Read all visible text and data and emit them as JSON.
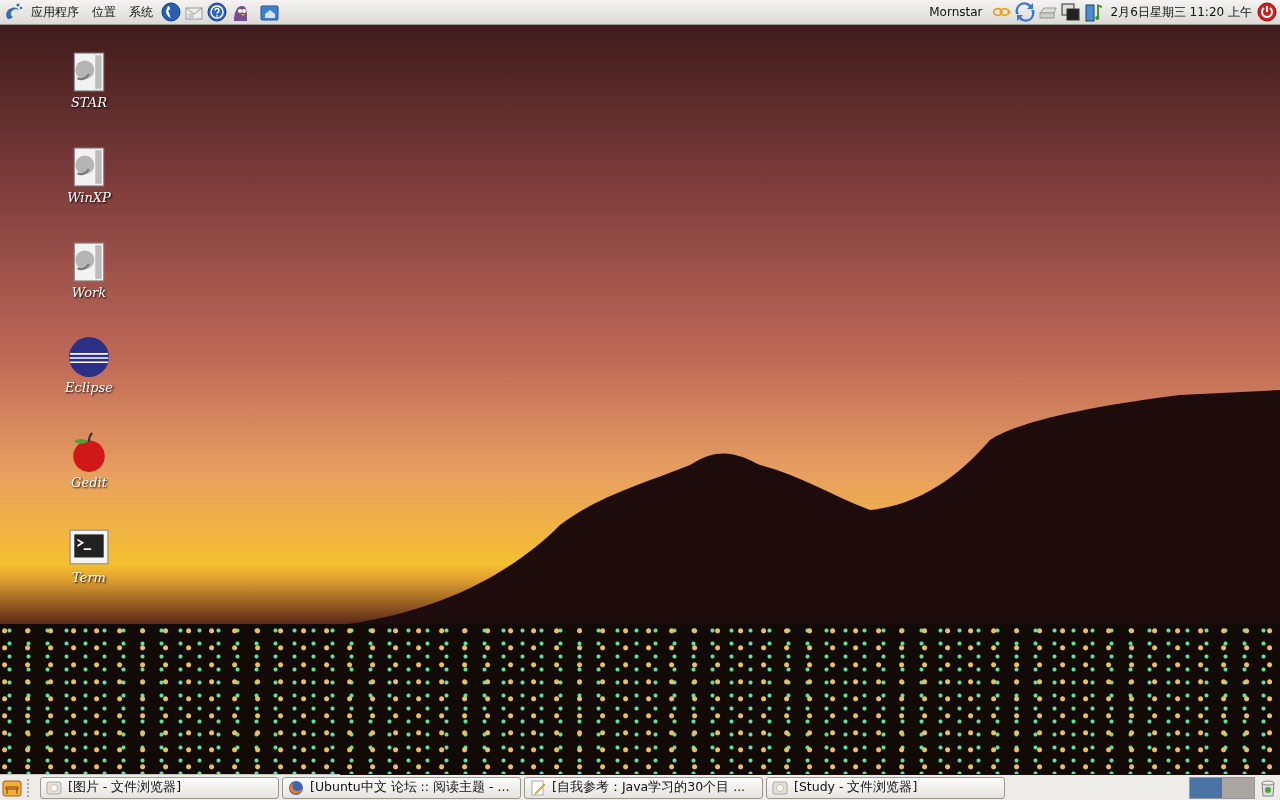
{
  "top_panel": {
    "menus": [
      "应用程序",
      "位置",
      "系统"
    ],
    "user": "Mornstar",
    "clock": "2月6日星期三 11:20 上午"
  },
  "desktop_icons": [
    {
      "label": "STAR",
      "kind": "drive"
    },
    {
      "label": "WinXP",
      "kind": "drive"
    },
    {
      "label": "Work",
      "kind": "drive"
    },
    {
      "label": "Eclipse",
      "kind": "sphere"
    },
    {
      "label": "Gedit",
      "kind": "apple"
    },
    {
      "label": "Term",
      "kind": "terminal"
    }
  ],
  "taskbar": {
    "tasks": [
      {
        "label": "[图片 - 文件浏览器]",
        "kind": "folder"
      },
      {
        "label": "[Ubuntu中文 论坛 :: 阅读主题 - ...",
        "kind": "browser"
      },
      {
        "label": "[自我参考：Java学习的30个目 ...",
        "kind": "editor"
      },
      {
        "label": "[Study - 文件浏览器]",
        "kind": "folder"
      }
    ],
    "workspaces": [
      {
        "selected": true
      },
      {
        "selected": false
      }
    ]
  }
}
